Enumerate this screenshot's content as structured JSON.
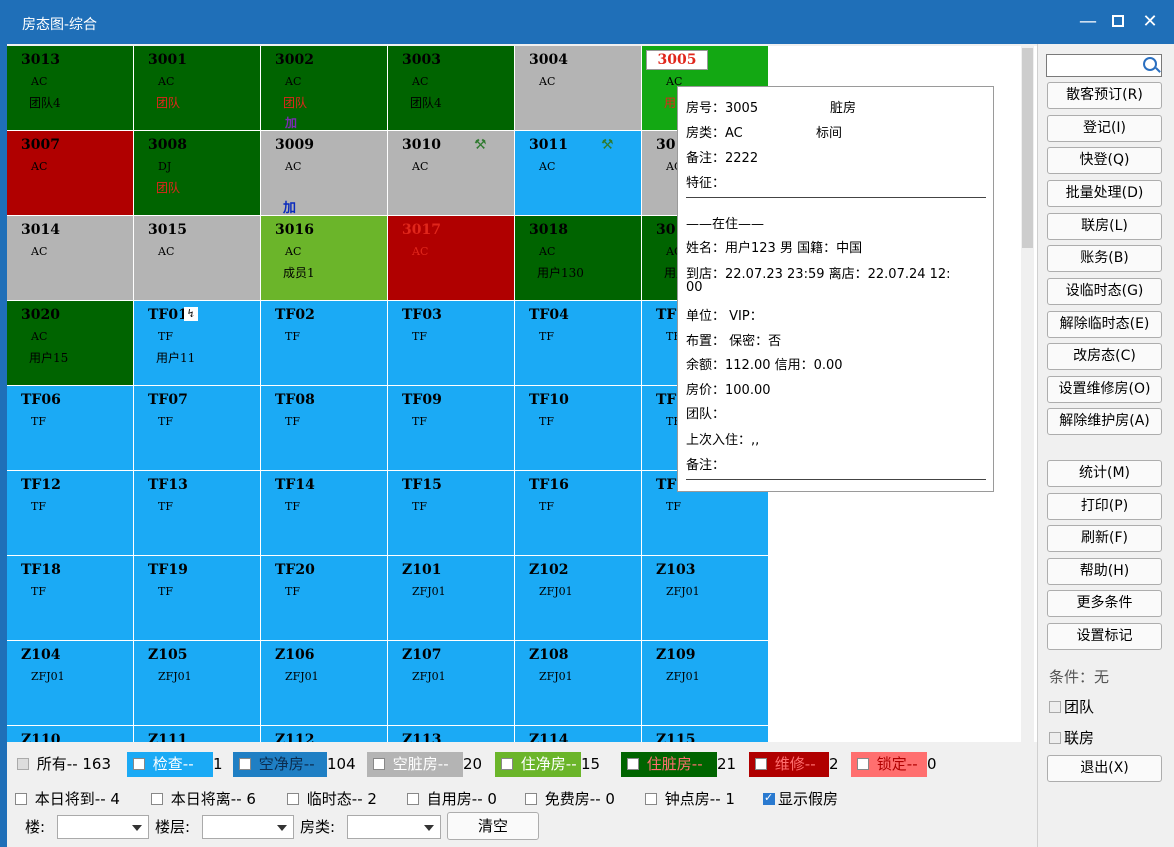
{
  "window": {
    "title": "房态图-综合"
  },
  "colors": {
    "occupied_dirty": "#006400",
    "vacant_dirty": "#b4b4b4",
    "vacant_clean": "#1baaf5",
    "maintenance": "#b00000",
    "occupied_clean": "#6bb52a",
    "check": "#1baaf5",
    "selected": "#13a813",
    "locked": "#ff6f6f"
  },
  "rooms": [
    {
      "no": "3013",
      "type": "AC",
      "guest": "团队4",
      "color": "occupied_dirty",
      "text": "dark"
    },
    {
      "no": "3001",
      "type": "AC",
      "guest": "团队",
      "color": "occupied_dirty",
      "text": "dark",
      "guest_red": true
    },
    {
      "no": "3002",
      "type": "AC",
      "guest": "团队",
      "color": "occupied_dirty",
      "text": "dark",
      "guest_red": true,
      "extra": "加"
    },
    {
      "no": "3003",
      "type": "AC",
      "guest": "团队4",
      "color": "occupied_dirty",
      "text": "dark"
    },
    {
      "no": "3004",
      "type": "AC",
      "color": "vacant_dirty",
      "text": "dark"
    },
    {
      "no": "3005",
      "type": "AC",
      "guest": "用",
      "color": "selected",
      "text": "dark",
      "guest_red": true,
      "boxed": true
    },
    {
      "no": "3007",
      "type": "AC",
      "color": "maintenance",
      "text": "dark"
    },
    {
      "no": "3008",
      "type": "DJ",
      "guest": "团队",
      "color": "occupied_dirty",
      "text": "dark",
      "guest_red": true
    },
    {
      "no": "3009",
      "type": "AC",
      "color": "vacant_dirty",
      "text": "dark",
      "extra": "加",
      "extra_blue": true
    },
    {
      "no": "3010",
      "type": "AC",
      "color": "vacant_dirty",
      "text": "dark",
      "tool": "⚒"
    },
    {
      "no": "3011",
      "type": "AC",
      "color": "vacant_clean",
      "text": "dark",
      "tool": "⚒"
    },
    {
      "no": "301",
      "type": "AC",
      "color": "vacant_dirty",
      "text": "dark"
    },
    {
      "no": "3014",
      "type": "AC",
      "color": "vacant_dirty",
      "text": "dark"
    },
    {
      "no": "3015",
      "type": "AC",
      "color": "vacant_dirty",
      "text": "dark"
    },
    {
      "no": "3016",
      "type": "AC",
      "guest": "成员1",
      "color": "occupied_clean",
      "text": "dark"
    },
    {
      "no": "3017",
      "type": "AC",
      "color": "maintenance",
      "text": "red"
    },
    {
      "no": "3018",
      "type": "AC",
      "guest": "用户130",
      "color": "occupied_dirty",
      "text": "dark"
    },
    {
      "no": "301",
      "type": "AC",
      "guest": "用户",
      "color": "occupied_dirty",
      "text": "dark"
    },
    {
      "no": "3020",
      "type": "AC",
      "guest": "用户15",
      "color": "occupied_dirty",
      "text": "dark"
    },
    {
      "no": "TF01",
      "type": "TF",
      "guest": "用户11",
      "color": "vacant_clean",
      "text": "dark",
      "mark": "↯"
    },
    {
      "no": "TF02",
      "type": "TF",
      "color": "vacant_clean",
      "text": "dark"
    },
    {
      "no": "TF03",
      "type": "TF",
      "color": "vacant_clean",
      "text": "dark"
    },
    {
      "no": "TF04",
      "type": "TF",
      "color": "vacant_clean",
      "text": "dark"
    },
    {
      "no": "TF0",
      "type": "TF",
      "color": "vacant_clean",
      "text": "dark"
    },
    {
      "no": "TF06",
      "type": "TF",
      "color": "vacant_clean",
      "text": "dark"
    },
    {
      "no": "TF07",
      "type": "TF",
      "color": "vacant_clean",
      "text": "dark"
    },
    {
      "no": "TF08",
      "type": "TF",
      "color": "vacant_clean",
      "text": "dark"
    },
    {
      "no": "TF09",
      "type": "TF",
      "color": "vacant_clean",
      "text": "dark"
    },
    {
      "no": "TF10",
      "type": "TF",
      "color": "vacant_clean",
      "text": "dark"
    },
    {
      "no": "TF1",
      "type": "TF",
      "color": "vacant_clean",
      "text": "dark"
    },
    {
      "no": "TF12",
      "type": "TF",
      "color": "vacant_clean",
      "text": "dark"
    },
    {
      "no": "TF13",
      "type": "TF",
      "color": "vacant_clean",
      "text": "dark"
    },
    {
      "no": "TF14",
      "type": "TF",
      "color": "vacant_clean",
      "text": "dark"
    },
    {
      "no": "TF15",
      "type": "TF",
      "color": "vacant_clean",
      "text": "dark"
    },
    {
      "no": "TF16",
      "type": "TF",
      "color": "vacant_clean",
      "text": "dark"
    },
    {
      "no": "TF1",
      "type": "TF",
      "color": "vacant_clean",
      "text": "dark"
    },
    {
      "no": "TF18",
      "type": "TF",
      "color": "vacant_clean",
      "text": "dark"
    },
    {
      "no": "TF19",
      "type": "TF",
      "color": "vacant_clean",
      "text": "dark"
    },
    {
      "no": "TF20",
      "type": "TF",
      "color": "vacant_clean",
      "text": "dark"
    },
    {
      "no": "Z101",
      "type": "ZFJ01",
      "color": "vacant_clean",
      "text": "dark"
    },
    {
      "no": "Z102",
      "type": "ZFJ01",
      "color": "vacant_clean",
      "text": "dark"
    },
    {
      "no": "Z103",
      "type": "ZFJ01",
      "color": "vacant_clean",
      "text": "dark"
    },
    {
      "no": "Z104",
      "type": "ZFJ01",
      "color": "vacant_clean",
      "text": "dark"
    },
    {
      "no": "Z105",
      "type": "ZFJ01",
      "color": "vacant_clean",
      "text": "dark"
    },
    {
      "no": "Z106",
      "type": "ZFJ01",
      "color": "vacant_clean",
      "text": "dark"
    },
    {
      "no": "Z107",
      "type": "ZFJ01",
      "color": "vacant_clean",
      "text": "dark"
    },
    {
      "no": "Z108",
      "type": "ZFJ01",
      "color": "vacant_clean",
      "text": "dark"
    },
    {
      "no": "Z109",
      "type": "ZFJ01",
      "color": "vacant_clean",
      "text": "dark"
    },
    {
      "no": "Z110",
      "color": "vacant_clean",
      "text": "dark"
    },
    {
      "no": "Z111",
      "color": "vacant_clean",
      "text": "dark"
    },
    {
      "no": "Z112",
      "color": "vacant_clean",
      "text": "dark"
    },
    {
      "no": "Z113",
      "color": "vacant_clean",
      "text": "dark"
    },
    {
      "no": "Z114",
      "color": "vacant_clean",
      "text": "dark"
    },
    {
      "no": "Z115",
      "color": "vacant_clean",
      "text": "dark"
    }
  ],
  "tooltip": {
    "lines": [
      "房号：3005",
      "脏房",
      "房类：AC",
      "标间",
      "备注：2222",
      "特征：",
      "——在住——",
      "姓名：用户123 男 国籍：中国",
      "到店：22.07.23 23:59  离店：22.07.24 12:",
      "00",
      "单位：   VIP：",
      "布置：   保密：否",
      "余额：112.00  信用：0.00",
      "房价：100.00",
      "团队：",
      "上次入住：,,",
      "备注："
    ]
  },
  "sidebar": {
    "search_placeholder": "",
    "buttons": [
      "散客预订(R)",
      "登记(I)",
      "快登(Q)",
      "批量处理(D)",
      "联房(L)",
      "账务(B)",
      "设临时态(G)",
      "解除临时态(E)",
      "改房态(C)",
      "设置维修房(O)",
      "解除维护房(A)",
      "统计(M)",
      "打印(P)",
      "刷新(F)",
      "帮助(H)",
      "更多条件",
      "设置标记"
    ],
    "condition_label": "条件：无",
    "check_team": "团队",
    "check_link": "联房",
    "exit_button": "退出(X)"
  },
  "legend": {
    "all": "所有-- 163",
    "items": [
      {
        "label": "检查--",
        "count": "1",
        "color": "check"
      },
      {
        "label": "空净房--",
        "count": "104",
        "color": "vacant_clean_dark"
      },
      {
        "label": "空脏房--",
        "count": "20",
        "color": "vacant_dirty"
      },
      {
        "label": "住净房--",
        "count": "15",
        "color": "occupied_clean"
      },
      {
        "label": "住脏房--",
        "count": "21",
        "color": "occupied_dirty"
      },
      {
        "label": "维修--",
        "count": "2",
        "color": "maintenance"
      },
      {
        "label": "锁定--",
        "count": "0",
        "color": "locked"
      }
    ]
  },
  "filters": {
    "row2": [
      "本日将到-- 4",
      "本日将离-- 6",
      "临时态-- 2",
      "自用房-- 0",
      "免费房-- 0",
      "钟点房-- 1"
    ],
    "show_fake": "显示假房",
    "building_label": "楼:",
    "floor_label": "楼层:",
    "roomtype_label": "房类:",
    "clear_button": "清空"
  }
}
